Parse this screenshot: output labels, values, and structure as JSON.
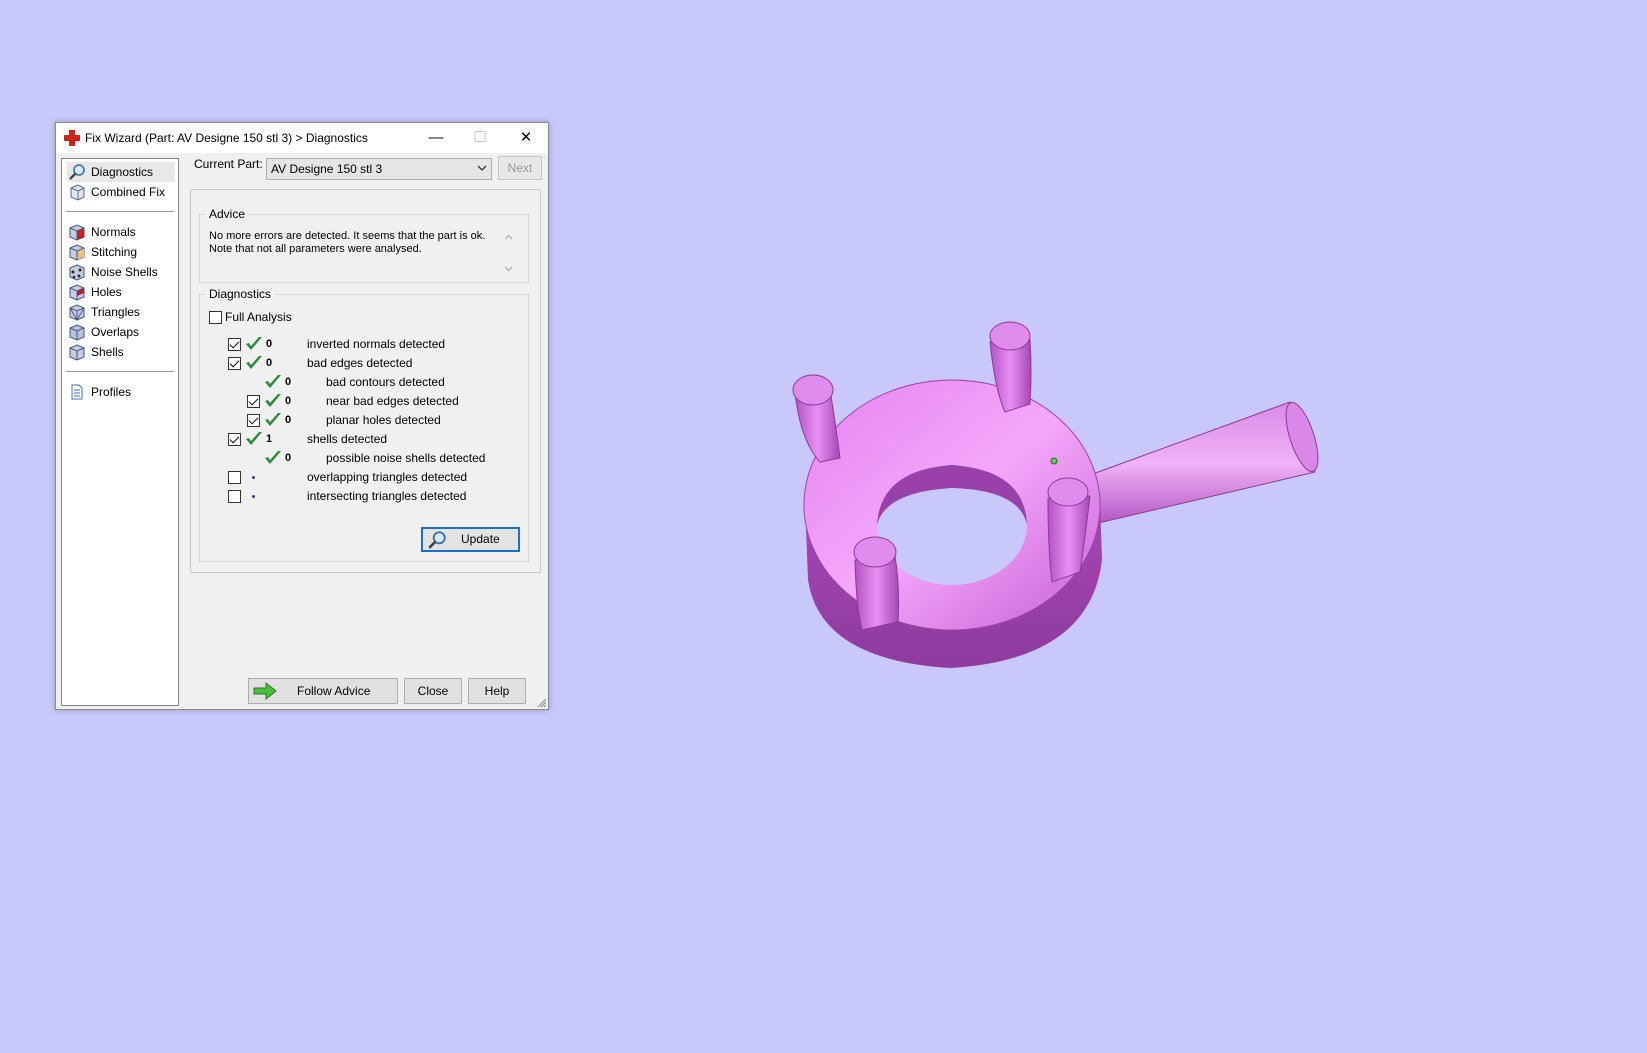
{
  "window": {
    "title": "Fix Wizard (Part: AV Designe 150 stl 3) > Diagnostics",
    "minimize_label": "—",
    "maximize_label": "☐",
    "close_label": "✕"
  },
  "sidebar": {
    "items": [
      {
        "label": "Diagnostics",
        "icon": "magnifier-icon"
      },
      {
        "label": "Combined Fix",
        "icon": "cube-icon"
      },
      {
        "label": "Normals",
        "icon": "normals-cube-icon"
      },
      {
        "label": "Stitching",
        "icon": "stitching-cube-icon"
      },
      {
        "label": "Noise Shells",
        "icon": "noise-shells-icon"
      },
      {
        "label": "Holes",
        "icon": "holes-cube-icon"
      },
      {
        "label": "Triangles",
        "icon": "triangles-cube-icon"
      },
      {
        "label": "Overlaps",
        "icon": "overlaps-cube-icon"
      },
      {
        "label": "Shells",
        "icon": "shells-cube-icon"
      },
      {
        "label": "Profiles",
        "icon": "document-icon"
      }
    ]
  },
  "header": {
    "current_part_label": "Current Part:",
    "current_part_value": "AV Designe 150 stl 3",
    "next_label": "Next"
  },
  "advice": {
    "title": "Advice",
    "text": "No more errors are detected. It seems that the part is ok. Note that not all parameters were analysed."
  },
  "diagnostics": {
    "title": "Diagnostics",
    "full_analysis_label": "Full Analysis",
    "full_analysis_checked": false,
    "rows": [
      {
        "checkbox": true,
        "checked": true,
        "status": "ok",
        "count": "0",
        "label": "inverted normals detected",
        "indent": 0
      },
      {
        "checkbox": true,
        "checked": true,
        "status": "ok",
        "count": "0",
        "label": "bad edges detected",
        "indent": 0
      },
      {
        "checkbox": false,
        "checked": false,
        "status": "ok",
        "count": "0",
        "label": "bad contours detected",
        "indent": 1
      },
      {
        "checkbox": true,
        "checked": true,
        "status": "ok",
        "count": "0",
        "label": "near bad edges detected",
        "indent": 1
      },
      {
        "checkbox": true,
        "checked": true,
        "status": "ok",
        "count": "0",
        "label": "planar holes detected",
        "indent": 1
      },
      {
        "checkbox": true,
        "checked": true,
        "status": "ok",
        "count": "1",
        "label": "shells detected",
        "indent": 0
      },
      {
        "checkbox": false,
        "checked": false,
        "status": "ok",
        "count": "0",
        "label": "possible noise shells detected",
        "indent": 1
      },
      {
        "checkbox": true,
        "checked": false,
        "status": "pending",
        "count": "",
        "label": "overlapping triangles detected",
        "indent": 0
      },
      {
        "checkbox": true,
        "checked": false,
        "status": "pending",
        "count": "",
        "label": "intersecting triangles detected",
        "indent": 0
      }
    ],
    "update_label": "Update"
  },
  "footer": {
    "follow_advice_label": "Follow Advice",
    "close_label": "Close",
    "help_label": "Help"
  },
  "colors": {
    "desktop_bg": "#c8c8fb",
    "model_color": "#c965d6",
    "tick_green": "#2f8a3c"
  }
}
